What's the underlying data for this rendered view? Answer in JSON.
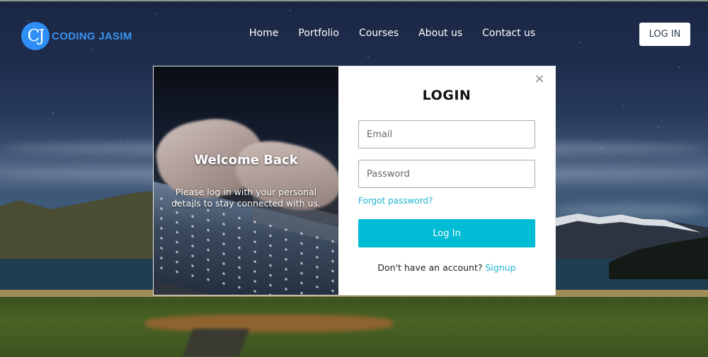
{
  "brand": {
    "logo_initials": "CJ",
    "name": "CODING JASIM",
    "color": "#2e8ef5"
  },
  "nav": {
    "items": [
      {
        "label": "Home"
      },
      {
        "label": "Portfolio"
      },
      {
        "label": "Courses"
      },
      {
        "label": "About us"
      },
      {
        "label": "Contact us"
      }
    ],
    "login_button": "LOG IN"
  },
  "modal": {
    "close_icon": "×",
    "panel": {
      "heading": "Welcome Back",
      "subtext": "Please log in with your personal details to stay connected with us."
    },
    "form": {
      "title": "LOGIN",
      "email": {
        "value": "",
        "placeholder": "Email"
      },
      "password": {
        "value": "",
        "placeholder": "Password"
      },
      "forgot_link": "Forgot password?",
      "submit_label": "Log In",
      "signup_prompt": "Don't have an account?",
      "signup_link": "Signup"
    },
    "accent_color": "#00bcd4",
    "link_color": "#1fb5cf"
  }
}
